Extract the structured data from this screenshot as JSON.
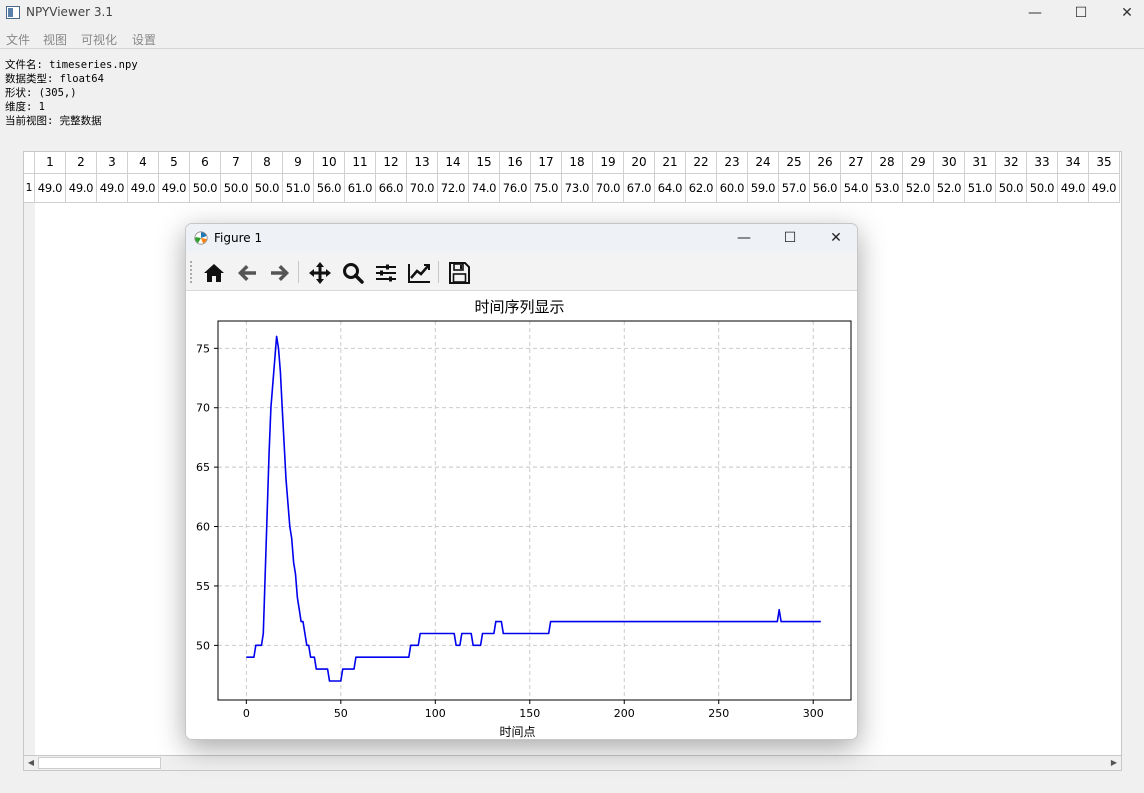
{
  "app": {
    "title": "NPYViewer 3.1",
    "minimize": "—",
    "maximize": "☐",
    "close": "✕"
  },
  "menu": {
    "file": "文件",
    "view": "视图",
    "visualize": "可视化",
    "settings": "设置"
  },
  "info": {
    "filename": "文件名: timeseries.npy",
    "dtype": "数据类型: float64",
    "shape": "形状: (305,)",
    "ndim": "维度: 1",
    "view": "当前视图: 完整数据"
  },
  "table": {
    "row_label": "1",
    "columns": [
      "1",
      "2",
      "3",
      "4",
      "5",
      "6",
      "7",
      "8",
      "9",
      "10",
      "11",
      "12",
      "13",
      "14",
      "15",
      "16",
      "17",
      "18",
      "19",
      "20",
      "21",
      "22",
      "23",
      "24",
      "25",
      "26",
      "27",
      "28",
      "29",
      "30",
      "31",
      "32",
      "33",
      "34",
      "35"
    ],
    "values": [
      "49.0",
      "49.0",
      "49.0",
      "49.0",
      "49.0",
      "50.0",
      "50.0",
      "50.0",
      "51.0",
      "56.0",
      "61.0",
      "66.0",
      "70.0",
      "72.0",
      "74.0",
      "76.0",
      "75.0",
      "73.0",
      "70.0",
      "67.0",
      "64.0",
      "62.0",
      "60.0",
      "59.0",
      "57.0",
      "56.0",
      "54.0",
      "53.0",
      "52.0",
      "52.0",
      "51.0",
      "50.0",
      "50.0",
      "49.0",
      "49.0"
    ]
  },
  "figure": {
    "title": "Figure 1",
    "minimize": "—",
    "maximize": "☐",
    "close": "✕",
    "tool_icons": [
      "home-icon",
      "back-icon",
      "forward-icon",
      "pan-icon",
      "zoom-icon",
      "subplots-icon",
      "customize-icon",
      "save-icon"
    ]
  },
  "chart_data": {
    "type": "line",
    "title": "时间序列显示",
    "xlabel": "时间点",
    "ylabel": "",
    "xlim": [
      -15,
      320
    ],
    "ylim": [
      45.4,
      77.3
    ],
    "xticks": [
      0,
      50,
      100,
      150,
      200,
      250,
      300
    ],
    "yticks": [
      50,
      55,
      60,
      65,
      70,
      75
    ],
    "grid": true,
    "grid_style": "dashed",
    "line_color": "#0000ee",
    "series": [
      {
        "points": [
          [
            0,
            49
          ],
          [
            4,
            49
          ],
          [
            5,
            50
          ],
          [
            8,
            50
          ],
          [
            9,
            51
          ],
          [
            10,
            56
          ],
          [
            11,
            61
          ],
          [
            12,
            66
          ],
          [
            13,
            70
          ],
          [
            14,
            72
          ],
          [
            15,
            74
          ],
          [
            16,
            76
          ],
          [
            17,
            75
          ],
          [
            18,
            73
          ],
          [
            19,
            70
          ],
          [
            20,
            67
          ],
          [
            21,
            64
          ],
          [
            22,
            62
          ],
          [
            23,
            60
          ],
          [
            24,
            59
          ],
          [
            25,
            57
          ],
          [
            26,
            56
          ],
          [
            27,
            54
          ],
          [
            28,
            53
          ],
          [
            29,
            52
          ],
          [
            30,
            52
          ],
          [
            31,
            51
          ],
          [
            32,
            50
          ],
          [
            33,
            50
          ],
          [
            34,
            49
          ],
          [
            36,
            49
          ],
          [
            37,
            48
          ],
          [
            43,
            48
          ],
          [
            44,
            47
          ],
          [
            50,
            47
          ],
          [
            51,
            48
          ],
          [
            57,
            48
          ],
          [
            58,
            49
          ],
          [
            86,
            49
          ],
          [
            87,
            50
          ],
          [
            91,
            50
          ],
          [
            92,
            51
          ],
          [
            110,
            51
          ],
          [
            111,
            50
          ],
          [
            113,
            50
          ],
          [
            114,
            51
          ],
          [
            119,
            51
          ],
          [
            120,
            50
          ],
          [
            124,
            50
          ],
          [
            125,
            51
          ],
          [
            131,
            51
          ],
          [
            132,
            52
          ],
          [
            135,
            52
          ],
          [
            136,
            51
          ],
          [
            160,
            51
          ],
          [
            161,
            52
          ],
          [
            281,
            52
          ],
          [
            282,
            53
          ],
          [
            283,
            52
          ],
          [
            304,
            52
          ]
        ]
      }
    ]
  }
}
